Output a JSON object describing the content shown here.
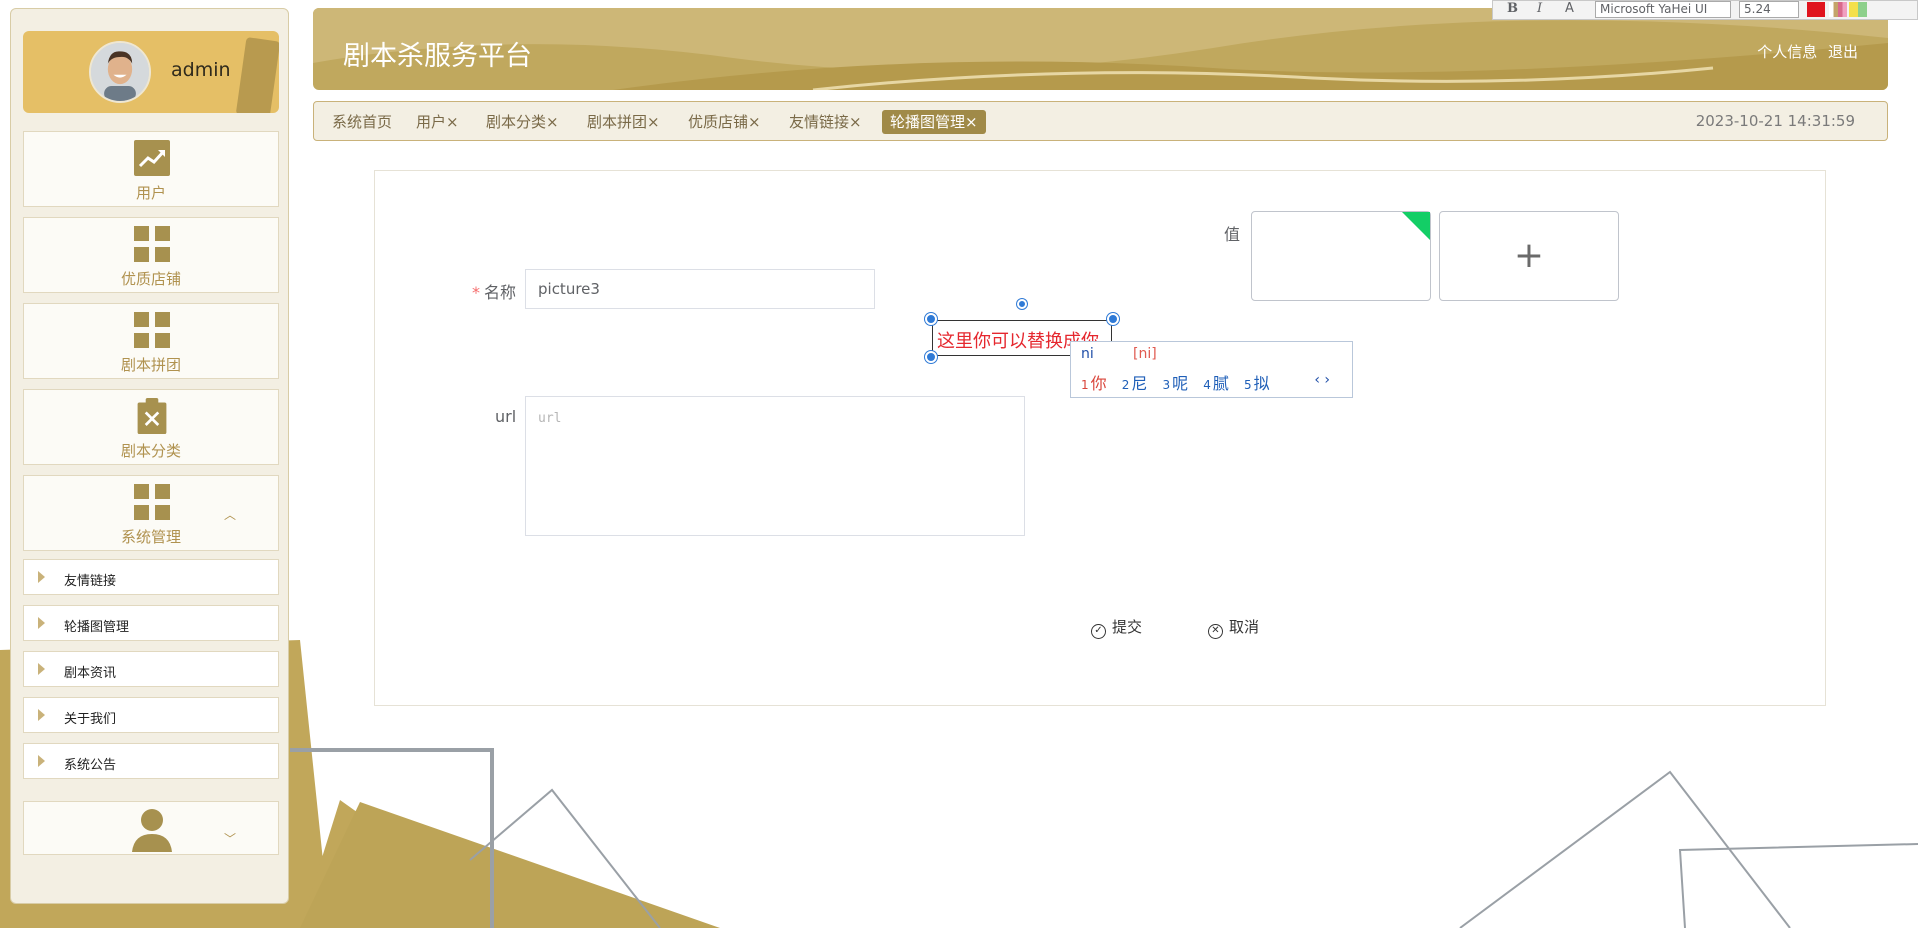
{
  "app": {
    "title": "剧本杀服务平台",
    "header_links": [
      "个人信息",
      "退出"
    ],
    "datetime": "2023-10-21 14:31:59"
  },
  "profile": {
    "name": "admin"
  },
  "sidebar": {
    "cards": [
      {
        "label": "用户",
        "icon": "trend-chart-icon"
      },
      {
        "label": "优质店铺",
        "icon": "grid-icon"
      },
      {
        "label": "剧本拼团",
        "icon": "grid-icon"
      },
      {
        "label": "剧本分类",
        "icon": "clipboard-x-icon"
      },
      {
        "label": "系统管理",
        "icon": "grid-icon",
        "caret": "︿"
      }
    ],
    "submenu": [
      "友情链接",
      "轮播图管理",
      "剧本资讯",
      "关于我们",
      "系统公告"
    ],
    "bottom_card": {
      "icon": "person-icon",
      "caret": "﹀"
    }
  },
  "tabs": [
    {
      "label": "系统首页"
    },
    {
      "label": "用户×"
    },
    {
      "label": "剧本分类×"
    },
    {
      "label": "剧本拼团×"
    },
    {
      "label": "优质店铺×"
    },
    {
      "label": "友情链接×"
    },
    {
      "label": "轮播图管理×",
      "active": true
    }
  ],
  "form": {
    "name_label": "名称",
    "required_mark": "*",
    "name_value": "picture3",
    "value_label": "值",
    "url_label": "url",
    "url_placeholder": "url",
    "upload_plus": "+",
    "submit_label": "提交",
    "cancel_label": "取消"
  },
  "overlay_textbox": {
    "text": "这里你可以替换成你"
  },
  "ime": {
    "input": "ni",
    "pinyin": "[ni]",
    "candidates": [
      {
        "n": "1",
        "char": "你"
      },
      {
        "n": "2",
        "char": "尼"
      },
      {
        "n": "3",
        "char": "呢"
      },
      {
        "n": "4",
        "char": "腻"
      },
      {
        "n": "5",
        "char": "拟"
      }
    ],
    "nav": "‹ ›"
  },
  "format_toolbar": {
    "bold": "B",
    "italic": "I",
    "font_icon": "A",
    "font_name": "Microsoft YaHei UI",
    "font_size": "5.24",
    "colors": [
      "#e0141e",
      "#ffffff",
      "#c4a46a",
      "#d96a8b",
      "#f0a0c0",
      "#f4e04a",
      "#8dd08b"
    ]
  },
  "theme": {
    "accent": "#c0a85e",
    "dark_accent": "#a08a48",
    "text_gold": "#b0924f"
  }
}
